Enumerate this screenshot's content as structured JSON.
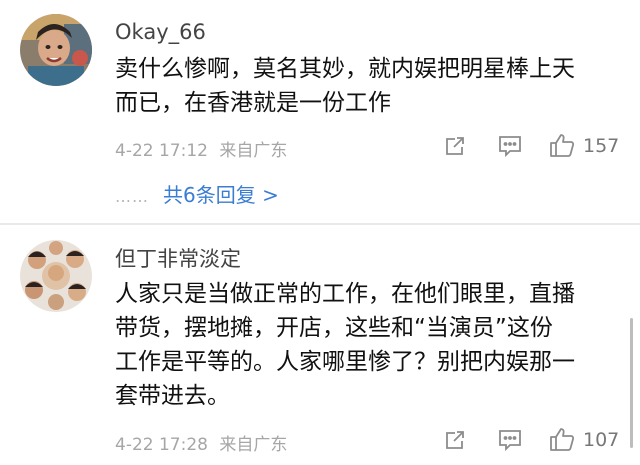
{
  "comments": [
    {
      "username": "Okay_66",
      "text_lines": [
        "卖什么惨啊，莫名其妙，就内娱把明星棒上天",
        "而已，在香港就是一份工作"
      ],
      "timestamp": "4-22 17:12",
      "source": "来自广东",
      "like_count": "157",
      "replies_label": "共6条回复 >",
      "replies_dots": "……"
    },
    {
      "username": "但丁非常淡定",
      "text_lines": [
        "人家只是当做正常的工作，在他们眼里，直播",
        "带货，摆地摊，开店，这些和“当演员”这份",
        "工作是平等的。人家哪里惨了？别把内娱那一",
        "套带进去。"
      ],
      "timestamp": "4-22 17:28",
      "source": "来自广东",
      "like_count": "107"
    }
  ],
  "icons": {
    "forward": "forward-icon",
    "comment": "comment-icon",
    "like": "thumbs-up-icon"
  },
  "colors": {
    "link": "#3a7dd2",
    "meta": "#a6a6a6",
    "divider": "#e9e9e9"
  }
}
